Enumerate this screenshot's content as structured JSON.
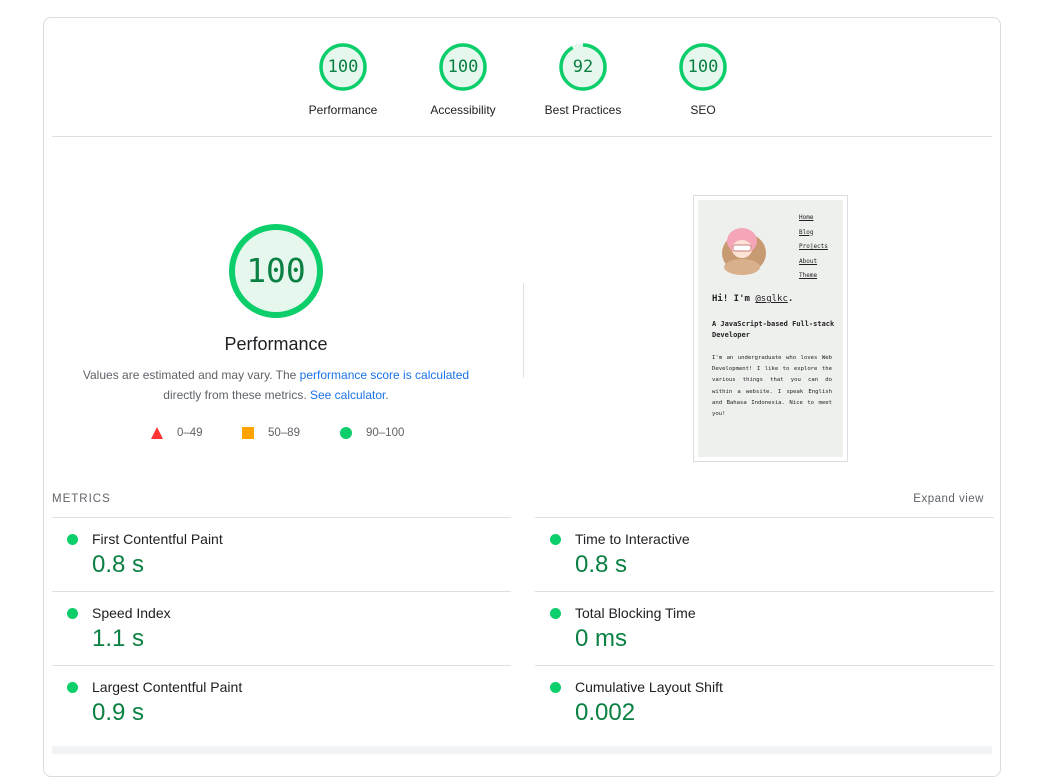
{
  "gauges": [
    {
      "score": "100",
      "label": "Performance"
    },
    {
      "score": "100",
      "label": "Accessibility"
    },
    {
      "score": "92",
      "label": "Best Practices"
    },
    {
      "score": "100",
      "label": "SEO"
    }
  ],
  "performance": {
    "score": "100",
    "title": "Performance",
    "desc_prefix": "Values are estimated and may vary. The ",
    "desc_link1": "performance score is calculated",
    "desc_middle": "directly from these metrics. ",
    "desc_link2": "See calculator",
    "desc_suffix": "."
  },
  "legend": [
    {
      "range": "0–49",
      "color": "#ff3333",
      "shape": "triangle"
    },
    {
      "range": "50–89",
      "color": "#ffa400",
      "shape": "square"
    },
    {
      "range": "90–100",
      "color": "#0cce6b",
      "shape": "circle"
    }
  ],
  "screenshot": {
    "nav": [
      "Home",
      "Blog",
      "Projects",
      "About",
      "Theme"
    ],
    "greeting": "Hi! I'm ",
    "handle": "@sglkc",
    "greeting_end": ".",
    "subtitle": "A JavaScript-based Full-stack Developer",
    "paragraph": "I'm an undergraduate who loves Web Development! I like to explore the various things that you can do within a website. I speak English and Bahasa Indonesia. Nice to meet you!"
  },
  "metrics_section": {
    "title": "METRICS",
    "expand_label": "Expand view"
  },
  "metrics": [
    {
      "name": "First Contentful Paint",
      "value": "0.8 s"
    },
    {
      "name": "Time to Interactive",
      "value": "0.8 s"
    },
    {
      "name": "Speed Index",
      "value": "1.1 s"
    },
    {
      "name": "Total Blocking Time",
      "value": "0 ms"
    },
    {
      "name": "Largest Contentful Paint",
      "value": "0.9 s"
    },
    {
      "name": "Cumulative Layout Shift",
      "value": "0.002"
    }
  ],
  "colors": {
    "pass": "#0cce6b",
    "pass_text": "#0b8043",
    "pass_fill": "#e6f8ee",
    "link": "#1a73e8"
  }
}
